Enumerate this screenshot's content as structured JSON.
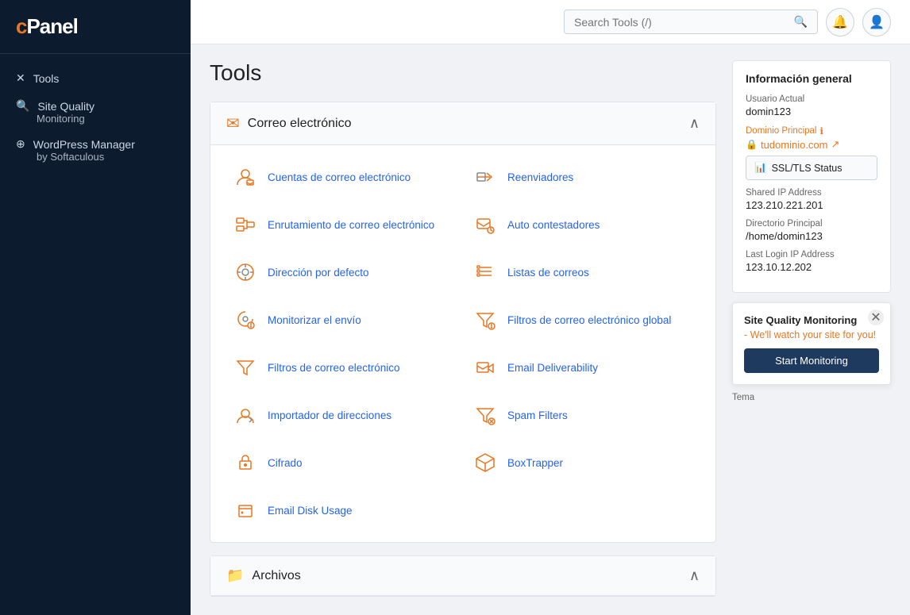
{
  "app": {
    "title": "cPanel",
    "logo_c": "c",
    "logo_panel": "Panel"
  },
  "sidebar": {
    "tools_label": "Tools",
    "site_quality_label": "Site Quality",
    "site_quality_sub": "Monitoring",
    "wordpress_label": "WordPress Manager",
    "wordpress_sub": "by Softaculous"
  },
  "header": {
    "search_placeholder": "Search Tools (/)",
    "search_value": ""
  },
  "main": {
    "page_title": "Tools"
  },
  "sections": [
    {
      "id": "correo",
      "icon": "✉",
      "title": "Correo electrónico",
      "tools": [
        {
          "label": "Cuentas de correo electrónico",
          "icon": "account-email"
        },
        {
          "label": "Reenviadores",
          "icon": "forward-email"
        },
        {
          "label": "Enrutamiento de correo electrónico",
          "icon": "route-email"
        },
        {
          "label": "Auto contestadores",
          "icon": "autoresponder"
        },
        {
          "label": "Dirección por defecto",
          "icon": "default-address"
        },
        {
          "label": "Listas de correos",
          "icon": "mailing-list"
        },
        {
          "label": "Monitorizar el envío",
          "icon": "monitor-send"
        },
        {
          "label": "Filtros de correo electrónico global",
          "icon": "global-filter"
        },
        {
          "label": "Filtros de correo electrónico",
          "icon": "filter-email"
        },
        {
          "label": "Email Deliverability",
          "icon": "deliverability"
        },
        {
          "label": "Importador de direcciones",
          "icon": "import-addresses"
        },
        {
          "label": "Spam Filters",
          "icon": "spam-filters"
        },
        {
          "label": "Cifrado",
          "icon": "encryption"
        },
        {
          "label": "BoxTrapper",
          "icon": "boxtrapper"
        },
        {
          "label": "Email Disk Usage",
          "icon": "disk-usage"
        }
      ]
    },
    {
      "id": "archivos",
      "icon": "📁",
      "title": "Archivos"
    }
  ],
  "info_panel": {
    "title": "Información general",
    "usuario_label": "Usuario Actual",
    "usuario_value": "domin123",
    "dominio_label": "Dominio Principal",
    "dominio_value": "tudominio.com",
    "ssl_btn_label": "SSL/TLS Status",
    "shared_ip_label": "Shared IP Address",
    "shared_ip_value": "123.210.221.201",
    "directorio_label": "Directorio Principal",
    "directorio_value": "/home/domin123",
    "last_login_label": "Last Login IP Address",
    "last_login_value": "123.10.12.202",
    "tema_label": "Tema"
  },
  "sqm_popup": {
    "title": "Site Quality Monitoring",
    "desc_normal": " - We'll watch your site for you!",
    "start_btn": "Start Monitoring"
  }
}
